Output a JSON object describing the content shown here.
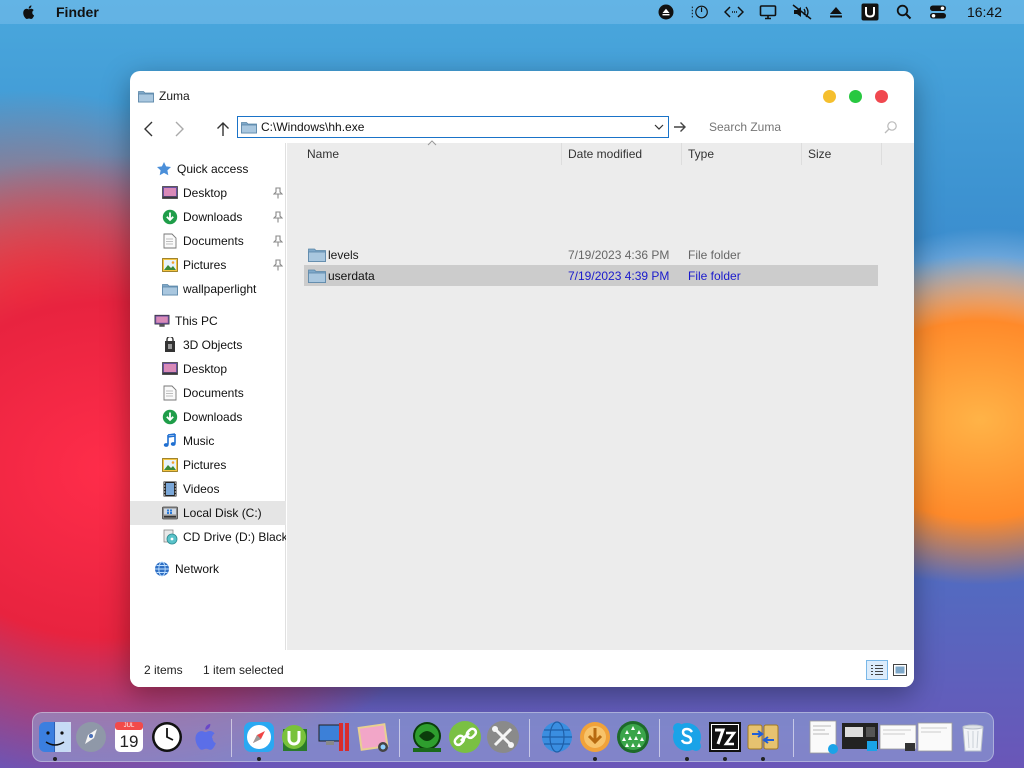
{
  "menubar": {
    "app_name": "Finder",
    "clock": "16:42",
    "icons": [
      "apple-icon",
      "eject-circle-icon",
      "power-icon",
      "code-icon",
      "display-icon",
      "mute-icon",
      "eject-icon",
      "u-icon",
      "search-icon",
      "control-center-icon"
    ]
  },
  "window": {
    "title": "Zuma",
    "address_value": "C:\\Windows\\hh.exe",
    "search_placeholder": "Search Zuma"
  },
  "sidebar": {
    "quick_access": {
      "label": "Quick access",
      "items": [
        {
          "label": "Desktop",
          "icon": "desktop-icon",
          "pinned": true
        },
        {
          "label": "Downloads",
          "icon": "downloads-icon",
          "pinned": true
        },
        {
          "label": "Documents",
          "icon": "documents-icon",
          "pinned": true
        },
        {
          "label": "Pictures",
          "icon": "pictures-icon",
          "pinned": true
        },
        {
          "label": "wallpaperlight",
          "icon": "folder-icon",
          "pinned": false
        }
      ]
    },
    "this_pc": {
      "label": "This PC",
      "items": [
        {
          "label": "3D Objects",
          "icon": "3d-objects-icon"
        },
        {
          "label": "Desktop",
          "icon": "desktop-icon"
        },
        {
          "label": "Documents",
          "icon": "documents-icon"
        },
        {
          "label": "Downloads",
          "icon": "downloads-icon"
        },
        {
          "label": "Music",
          "icon": "music-icon"
        },
        {
          "label": "Pictures",
          "icon": "pictures-icon"
        },
        {
          "label": "Videos",
          "icon": "videos-icon"
        },
        {
          "label": "Local Disk (C:)",
          "icon": "local-disk-icon",
          "selected": true
        },
        {
          "label": "CD Drive (D:) Black",
          "icon": "cd-drive-icon"
        }
      ]
    },
    "network": {
      "label": "Network",
      "icon": "network-icon"
    }
  },
  "columns": [
    "Name",
    "Date modified",
    "Type",
    "Size"
  ],
  "files": [
    {
      "name": "levels",
      "date": "7/19/2023 4:36 PM",
      "type": "File folder",
      "size": "",
      "selected": false
    },
    {
      "name": "userdata",
      "date": "7/19/2023 4:39 PM",
      "type": "File folder",
      "size": "",
      "selected": true
    }
  ],
  "status": {
    "item_count": "2 items",
    "selection": "1 item selected"
  },
  "dock": {
    "apps": [
      "finder-icon",
      "launchpad-icon",
      "calendar-icon",
      "clock-icon",
      "macos-icon",
      "safari-icon",
      "utorrent-icon",
      "parallels-icon",
      "photos-icon",
      "collection-icon",
      "link-icon",
      "system-tools-icon",
      "network-globe-icon",
      "download-icon",
      "drops-icon",
      "skype-icon",
      "7zip-icon",
      "file-compare-icon",
      "window-thumb-1",
      "window-thumb-2",
      "window-thumb-3",
      "window-thumb-4",
      "trash-icon"
    ],
    "calendar_month": "JUL",
    "calendar_day": "19"
  }
}
